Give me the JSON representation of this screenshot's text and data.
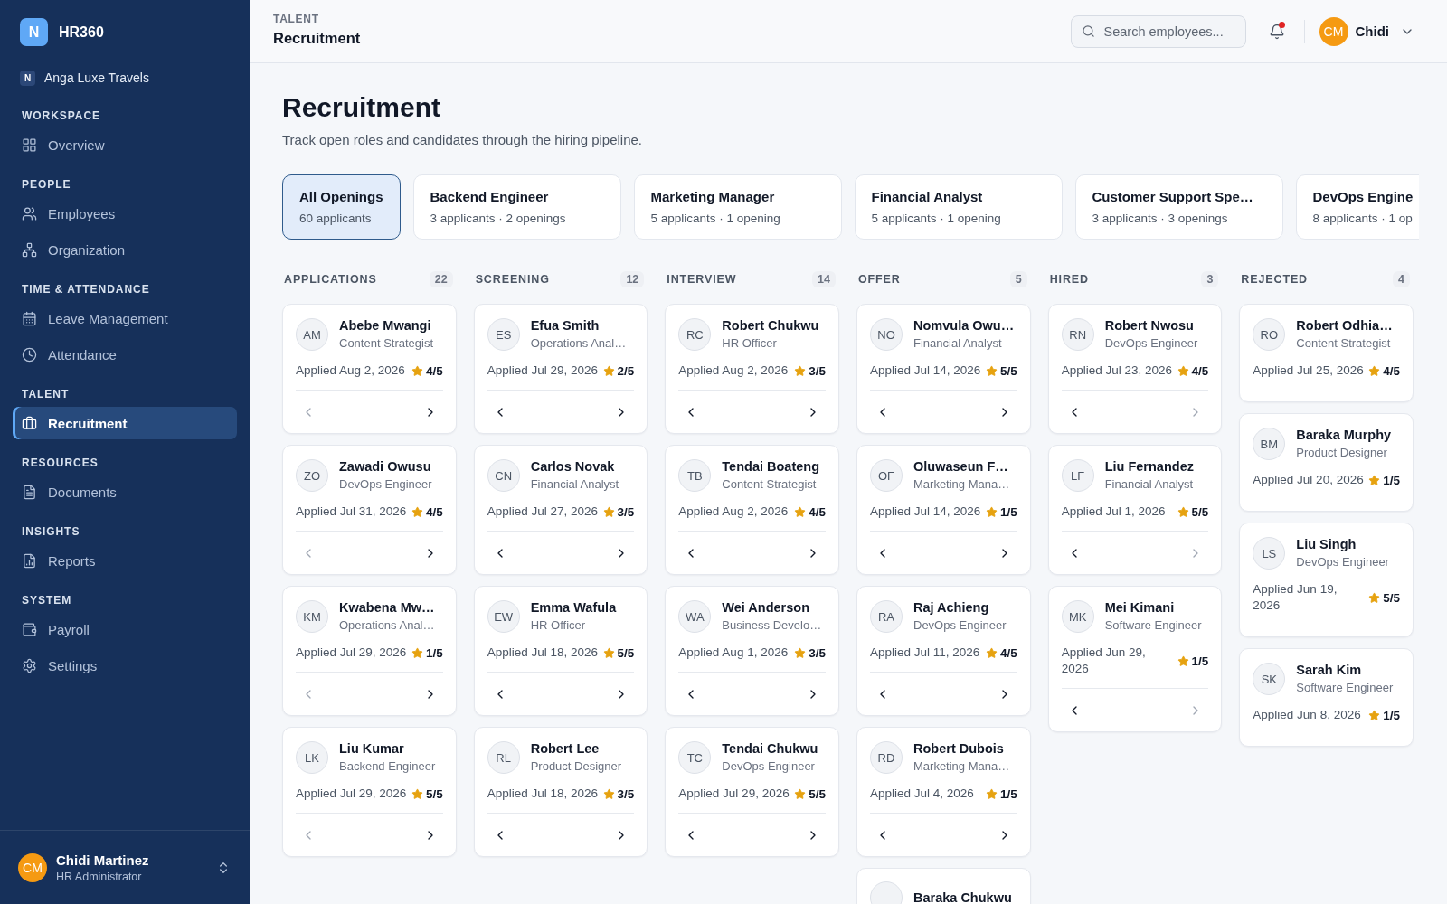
{
  "sidebar": {
    "brand": {
      "logo": "N",
      "name": "HR360"
    },
    "organization": {
      "badge": "N",
      "name": "Anga Luxe Travels"
    },
    "sections": [
      {
        "label": "WORKSPACE",
        "items": [
          {
            "label": "Overview",
            "selected": false
          }
        ]
      },
      {
        "label": "PEOPLE",
        "items": [
          {
            "label": "Employees",
            "selected": false
          },
          {
            "label": "Organization",
            "selected": false
          }
        ]
      },
      {
        "label": "TIME & ATTENDANCE",
        "items": [
          {
            "label": "Leave Management",
            "selected": false
          },
          {
            "label": "Attendance",
            "selected": false
          }
        ]
      },
      {
        "label": "TALENT",
        "items": [
          {
            "label": "Recruitment",
            "selected": true
          }
        ]
      },
      {
        "label": "RESOURCES",
        "items": [
          {
            "label": "Documents",
            "selected": false
          }
        ]
      },
      {
        "label": "INSIGHTS",
        "items": [
          {
            "label": "Reports",
            "selected": false
          }
        ]
      },
      {
        "label": "SYSTEM",
        "items": [
          {
            "label": "Payroll",
            "selected": false
          },
          {
            "label": "Settings",
            "selected": false
          }
        ]
      }
    ],
    "user": {
      "initials": "CM",
      "name": "Chidi Martinez",
      "role": "HR Administrator"
    }
  },
  "header": {
    "breadcrumb": "TALENT",
    "title": "Recruitment",
    "search": {
      "placeholder": "Search employees..."
    },
    "notifications": {
      "unread": true
    },
    "user": {
      "initials": "CM",
      "name": "Chidi"
    }
  },
  "page": {
    "title": "Recruitment",
    "subtitle": "Track open roles and candidates through the hiring pipeline."
  },
  "openings": [
    {
      "kind": "all",
      "title": "All Openings",
      "meta": "60 applicants",
      "selected": true
    },
    {
      "kind": "opening",
      "title": "Backend Engineer",
      "meta": "3 applicants · 2 openings",
      "selected": false
    },
    {
      "kind": "opening",
      "title": "Marketing Manager",
      "meta": "5 applicants · 1 opening",
      "selected": false
    },
    {
      "kind": "opening",
      "title": "Financial Analyst",
      "meta": "5 applicants · 1 opening",
      "selected": false
    },
    {
      "kind": "opening",
      "title": "Customer Support Spe…",
      "meta": "3 applicants · 3 openings",
      "selected": false
    },
    {
      "kind": "opening",
      "title": "DevOps Engine",
      "meta": "8 applicants · 1 op",
      "selected": false
    }
  ],
  "pipeline": [
    {
      "stage": "APPLICATIONS",
      "count": "22",
      "nav": {
        "prev_disabled": true,
        "next_disabled": false
      },
      "candidates": [
        {
          "initials": "AM",
          "name": "Abebe Mwangi",
          "role": "Content Strategist",
          "applied": "Applied Aug 2, 2026",
          "rating": "4/5"
        },
        {
          "initials": "ZO",
          "name": "Zawadi Owusu",
          "role": "DevOps Engineer",
          "applied": "Applied Jul 31, 2026",
          "rating": "4/5"
        },
        {
          "initials": "KM",
          "name": "Kwabena Mw…",
          "role": "Operations Anal…",
          "applied": "Applied Jul 29, 2026",
          "rating": "1/5"
        },
        {
          "initials": "LK",
          "name": "Liu Kumar",
          "role": "Backend Engineer",
          "applied": "Applied Jul 29, 2026",
          "rating": "5/5"
        }
      ]
    },
    {
      "stage": "SCREENING",
      "count": "12",
      "nav": {
        "prev_disabled": false,
        "next_disabled": false
      },
      "candidates": [
        {
          "initials": "ES",
          "name": "Efua Smith",
          "role": "Operations Anal…",
          "applied": "Applied Jul 29, 2026",
          "rating": "2/5"
        },
        {
          "initials": "CN",
          "name": "Carlos Novak",
          "role": "Financial Analyst",
          "applied": "Applied Jul 27, 2026",
          "rating": "3/5"
        },
        {
          "initials": "EW",
          "name": "Emma Wafula",
          "role": "HR Officer",
          "applied": "Applied Jul 18, 2026",
          "rating": "5/5"
        },
        {
          "initials": "RL",
          "name": "Robert Lee",
          "role": "Product Designer",
          "applied": "Applied Jul 18, 2026",
          "rating": "3/5"
        }
      ]
    },
    {
      "stage": "INTERVIEW",
      "count": "14",
      "nav": {
        "prev_disabled": false,
        "next_disabled": false
      },
      "candidates": [
        {
          "initials": "RC",
          "name": "Robert Chukwu",
          "role": "HR Officer",
          "applied": "Applied Aug 2, 2026",
          "rating": "3/5"
        },
        {
          "initials": "TB",
          "name": "Tendai Boateng",
          "role": "Content Strategist",
          "applied": "Applied Aug 2, 2026",
          "rating": "4/5"
        },
        {
          "initials": "WA",
          "name": "Wei Anderson",
          "role": "Business Develo…",
          "applied": "Applied Aug 1, 2026",
          "rating": "3/5"
        },
        {
          "initials": "TC",
          "name": "Tendai Chukwu",
          "role": "DevOps Engineer",
          "applied": "Applied Jul 29, 2026",
          "rating": "5/5"
        }
      ]
    },
    {
      "stage": "OFFER",
      "count": "5",
      "nav": {
        "prev_disabled": false,
        "next_disabled": false
      },
      "candidates": [
        {
          "initials": "NO",
          "name": "Nomvula Owu…",
          "role": "Financial Analyst",
          "applied": "Applied Jul 14, 2026",
          "rating": "5/5"
        },
        {
          "initials": "OF",
          "name": "Oluwaseun F…",
          "role": "Marketing Mana…",
          "applied": "Applied Jul 14, 2026",
          "rating": "1/5"
        },
        {
          "initials": "RA",
          "name": "Raj Achieng",
          "role": "DevOps Engineer",
          "applied": "Applied Jul 11, 2026",
          "rating": "4/5"
        },
        {
          "initials": "RD",
          "name": "Robert Dubois",
          "role": "Marketing Mana…",
          "applied": "Applied Jul 4, 2026",
          "rating": "1/5"
        },
        {
          "name": "Baraka Chukwu"
        }
      ]
    },
    {
      "stage": "HIRED",
      "count": "3",
      "nav": {
        "prev_disabled": false,
        "next_disabled": true
      },
      "candidates": [
        {
          "initials": "RN",
          "name": "Robert Nwosu",
          "role": "DevOps Engineer",
          "applied": "Applied Jul 23, 2026",
          "rating": "4/5"
        },
        {
          "initials": "LF",
          "name": "Liu Fernandez",
          "role": "Financial Analyst",
          "applied": "Applied Jul 1, 2026",
          "rating": "5/5"
        },
        {
          "initials": "MK",
          "name": "Mei Kimani",
          "role": "Software Engineer",
          "applied": "Applied Jun 29, 2026",
          "rating": "1/5"
        }
      ]
    },
    {
      "stage": "REJECTED",
      "count": "4",
      "candidates": [
        {
          "initials": "RO",
          "name": "Robert Odhia…",
          "role": "Content Strategist",
          "applied": "Applied Jul 25, 2026",
          "rating": "4/5"
        },
        {
          "initials": "BM",
          "name": "Baraka Murphy",
          "role": "Product Designer",
          "applied": "Applied Jul 20, 2026",
          "rating": "1/5"
        },
        {
          "initials": "LS",
          "name": "Liu Singh",
          "role": "DevOps Engineer",
          "applied": "Applied Jun 19, 2026",
          "rating": "5/5"
        },
        {
          "initials": "SK",
          "name": "Sarah Kim",
          "role": "Software Engineer",
          "applied": "Applied Jun 8, 2026",
          "rating": "1/5"
        }
      ]
    }
  ]
}
